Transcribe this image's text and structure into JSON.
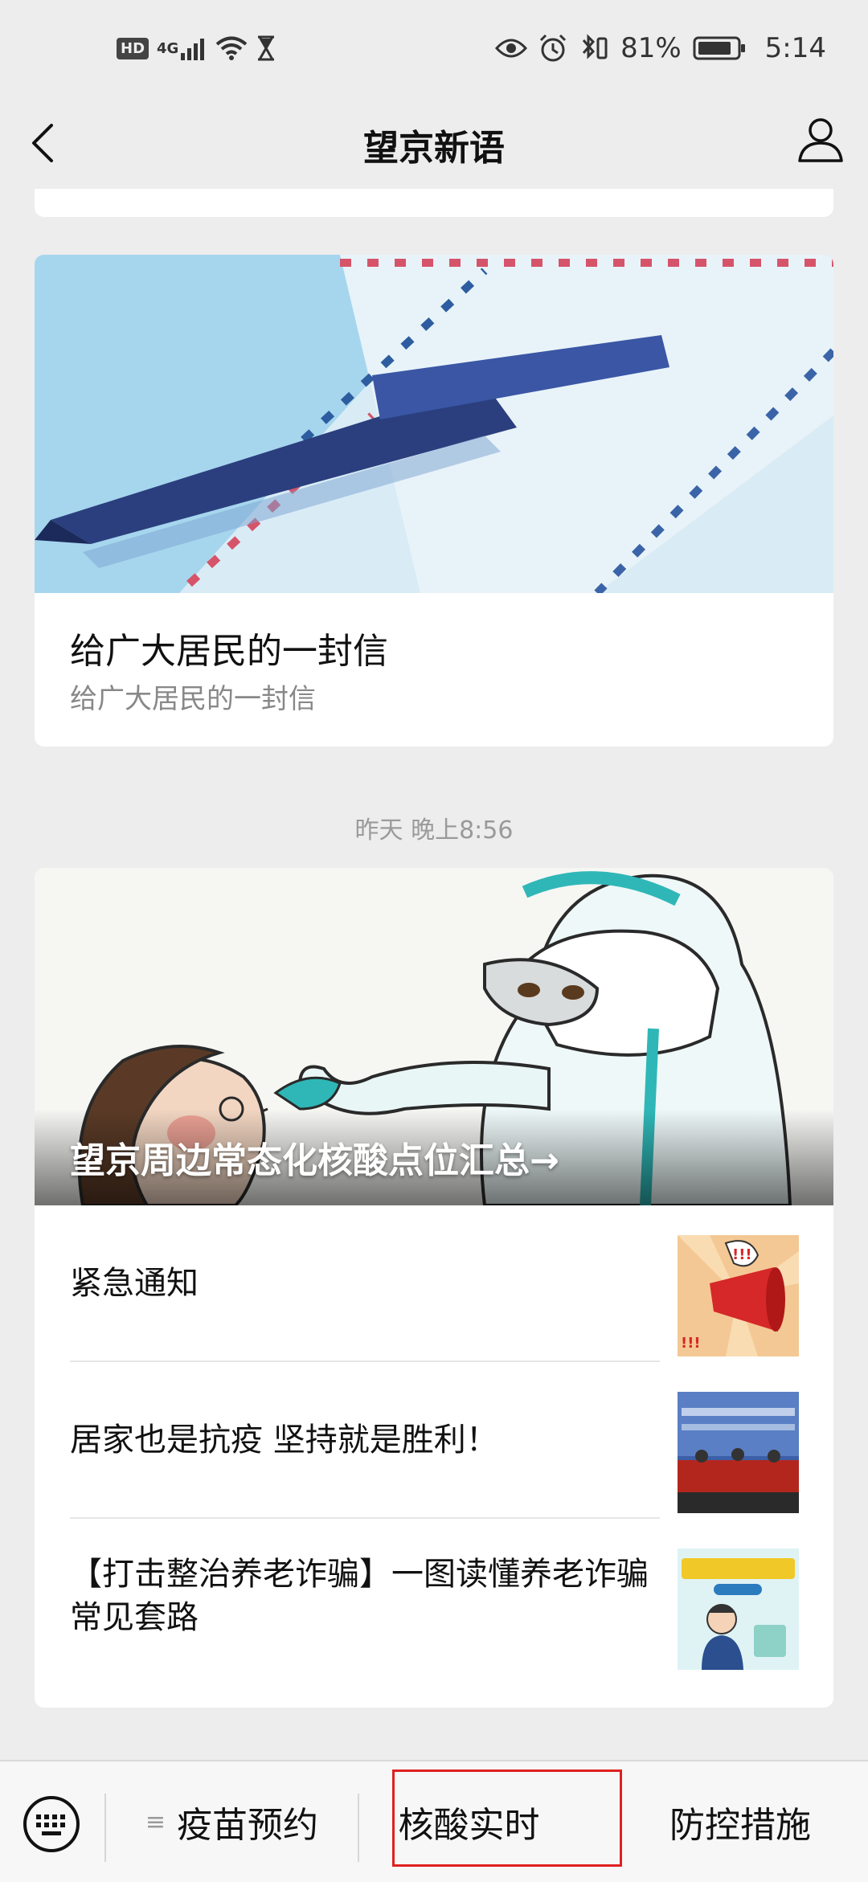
{
  "status_bar": {
    "hd": "HD",
    "network": "4G",
    "battery": "81%",
    "time": "5:14"
  },
  "nav": {
    "title": "望京新语"
  },
  "feed": {
    "article1": {
      "title": "给广大居民的一封信",
      "subtitle": "给广大居民的一封信"
    },
    "timestamp": "昨天 晚上8:56",
    "article2": {
      "cover_title": "望京周边常态化核酸点位汇总→",
      "items": [
        {
          "title": "紧急通知"
        },
        {
          "title": "居家也是抗疫 坚持就是胜利！"
        },
        {
          "title": "【打击整治养老诈骗】一图读懂养老诈骗常见套路"
        }
      ]
    }
  },
  "bottom_menu": {
    "menu1_icon": "≡",
    "menu1": "疫苗预约",
    "menu2": "核酸实时",
    "menu3": "防控措施"
  },
  "colors": {
    "background": "#ededed",
    "highlight": "#e02020"
  }
}
